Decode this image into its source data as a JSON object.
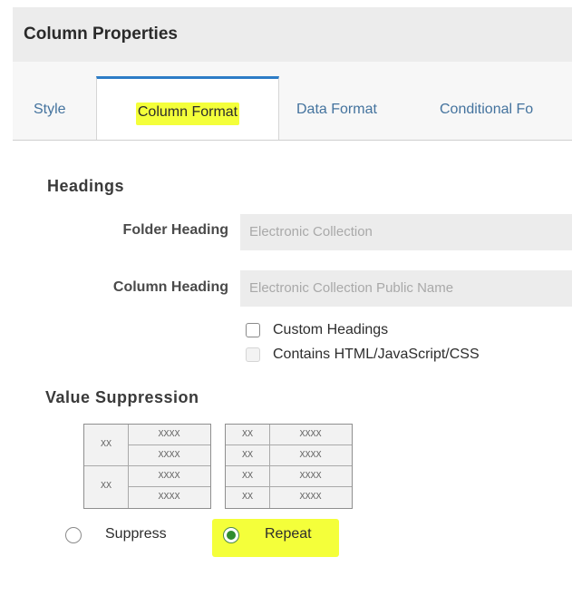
{
  "dialog": {
    "title": "Column Properties"
  },
  "tabs": [
    {
      "label": "Style",
      "active": false
    },
    {
      "label": "Column Format",
      "active": true,
      "highlighted": true
    },
    {
      "label": "Data Format",
      "active": false
    },
    {
      "label": "Conditional Fo",
      "active": false
    }
  ],
  "headings": {
    "section_title": "Headings",
    "folder_heading_label": "Folder Heading",
    "folder_heading_value": "Electronic Collection",
    "column_heading_label": "Column Heading",
    "column_heading_value": "Electronic Collection Public Name",
    "custom_headings_label": "Custom Headings",
    "custom_headings_checked": false,
    "contains_html_label": "Contains HTML/JavaScript/CSS",
    "contains_html_checked": false,
    "contains_html_disabled": true
  },
  "value_suppression": {
    "section_title": "Value Suppression",
    "preview_suppress": {
      "left": [
        "XX",
        "XX"
      ],
      "right": [
        "XXXX",
        "XXXX",
        "XXXX",
        "XXXX"
      ]
    },
    "preview_repeat": {
      "left": [
        "XX",
        "XX",
        "XX",
        "XX"
      ],
      "right": [
        "XXXX",
        "XXXX",
        "XXXX",
        "XXXX"
      ]
    },
    "suppress_label": "Suppress",
    "repeat_label": "Repeat",
    "selected": "Repeat"
  },
  "colors": {
    "highlight": "#f4ff3a",
    "tab_accent": "#2d7cc6",
    "radio_selected": "#2f8c2f"
  }
}
